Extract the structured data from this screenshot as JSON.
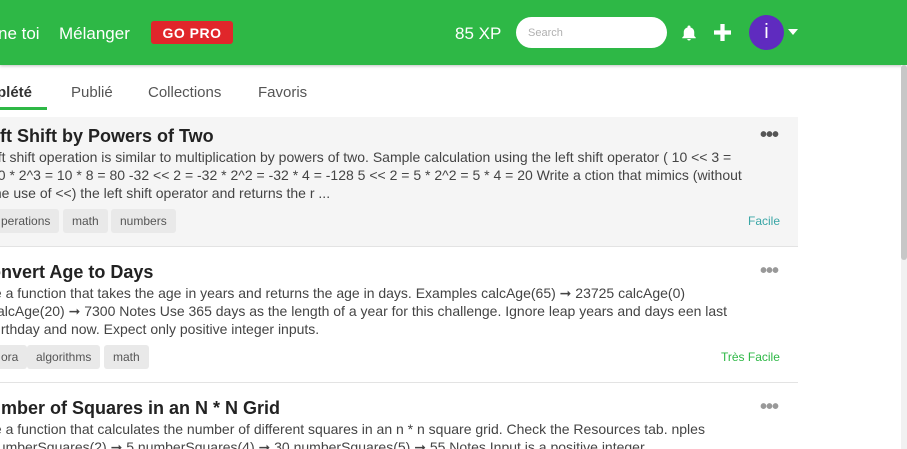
{
  "header": {
    "nav": [
      "ne toi",
      "Mélanger"
    ],
    "go_pro": "GO PRO",
    "xp": "85 XP",
    "search_placeholder": "Search",
    "avatar_letter": "i",
    "brand_color": "#2eb846"
  },
  "tabs": [
    "plété",
    "Publié",
    "Collections",
    "Favoris"
  ],
  "active_tab": 0,
  "challenges": [
    {
      "title": "eft Shift by Powers of Two",
      "description": "eft shift operation is similar to multiplication by powers of two. Sample calculation using the left shift operator ( 10 << 3 = 10 * 2^3 = 10 * 8 = 80 -32 << 2 = -32 * 2^2 = -32 * 4 = -128 5 << 2 = 5 * 2^2 = 5 * 4 = 20 Write a ction that mimics (without the use of <<) the left shift operator and returns the r ...",
      "tags": [
        "perations",
        "math",
        "numbers"
      ],
      "difficulty": "Facile",
      "difficulty_color": "#3aa6a6",
      "more": "•••"
    },
    {
      "title": "onvert Age to Days",
      "description": "te a function that takes the age in years and returns the age in days. Examples calcAge(65) ➞ 23725 calcAge(0) calcAge(20) ➞ 7300 Notes Use 365 days as the length of a year for this challenge. Ignore leap years and days een last birthday and now. Expect only positive integer inputs.",
      "tags": [
        "ora",
        "algorithms",
        "math"
      ],
      "difficulty": "Très Facile",
      "difficulty_color": "#2eb846",
      "more": "•••"
    },
    {
      "title": "umber of Squares in an N * N Grid",
      "description": "te a function that calculates the number of different squares in an n * n square grid. Check the Resources tab. nples numberSquares(2) ➞ 5 numberSquares(4) ➞ 30 numberSquares(5) ➞ 55 Notes Input is a positive integer.",
      "more": "•••"
    }
  ]
}
